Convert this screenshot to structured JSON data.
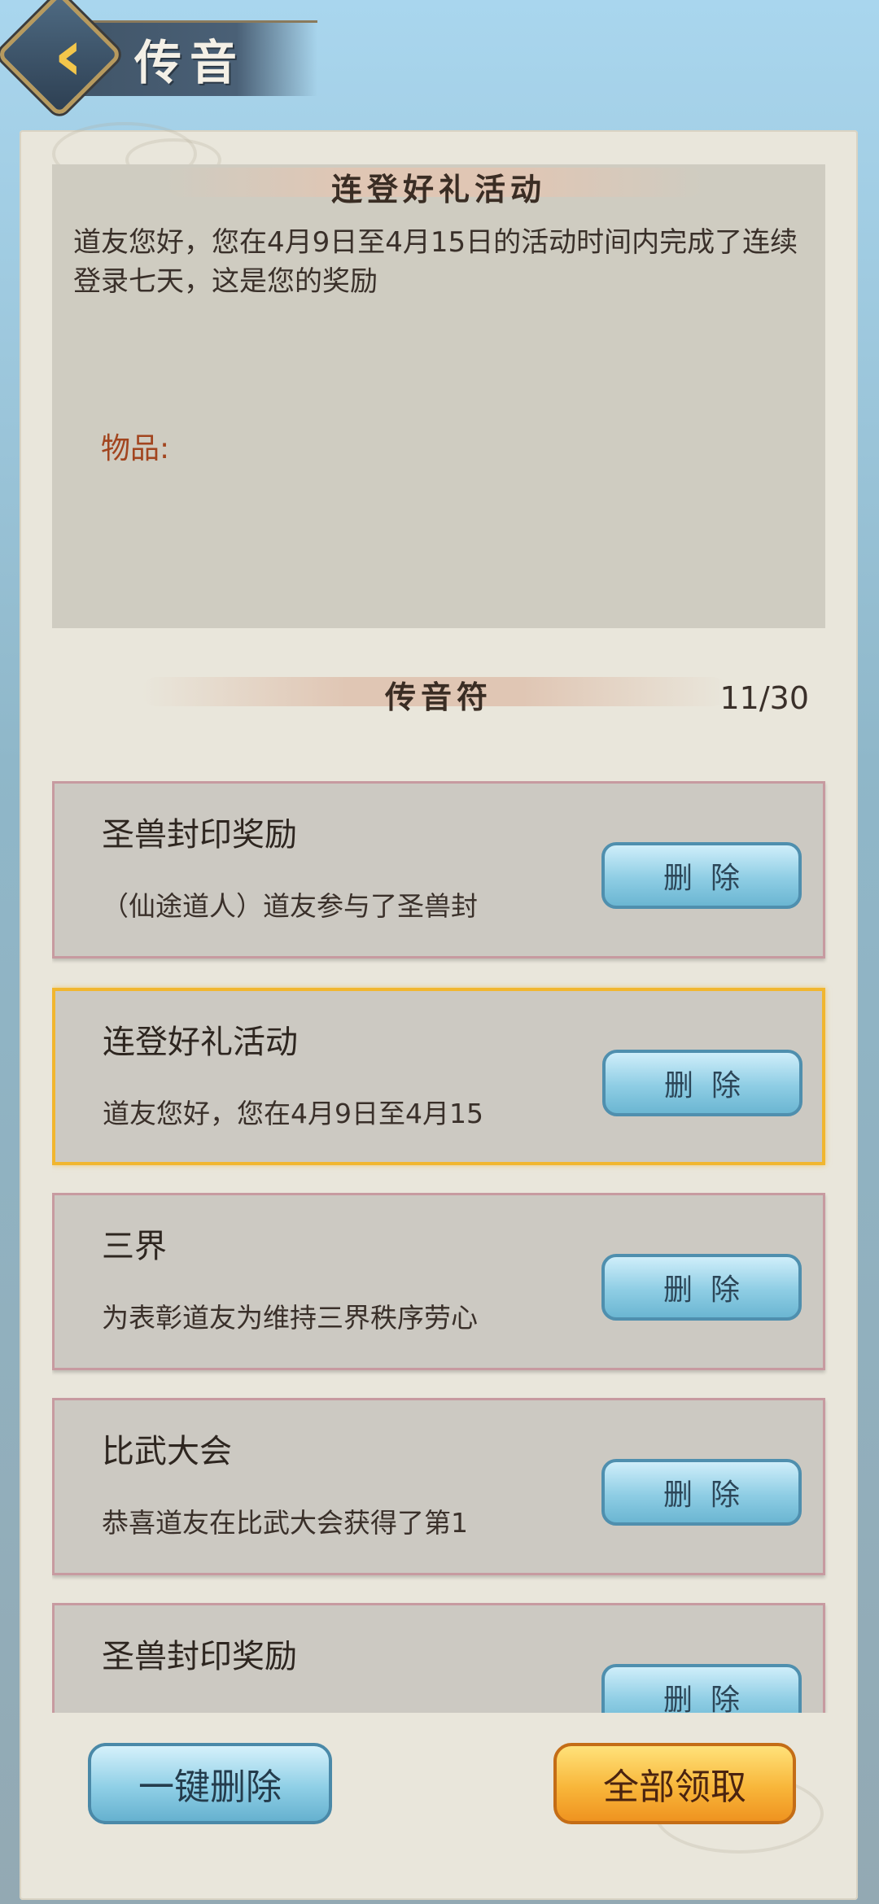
{
  "header": {
    "title": "传音",
    "back_icon": "chevron-left-icon"
  },
  "message": {
    "title": "连登好礼活动",
    "body": "道友您好，您在4月9日至4月15日的活动时间内完成了连续登录七天，这是您的奖励",
    "items_label": "物品:"
  },
  "list": {
    "section_title": "传音符",
    "count": "11/30",
    "items": [
      {
        "title": "圣兽封印奖励",
        "preview": "（仙途道人）道友参与了圣兽封",
        "delete_label": "删除",
        "selected": false
      },
      {
        "title": "连登好礼活动",
        "preview": "道友您好，您在4月9日至4月15",
        "delete_label": "删除",
        "selected": true
      },
      {
        "title": "三界",
        "preview": "为表彰道友为维持三界秩序劳心",
        "delete_label": "删除",
        "selected": false
      },
      {
        "title": "比武大会",
        "preview": "恭喜道友在比武大会获得了第1",
        "delete_label": "删除",
        "selected": false
      },
      {
        "title": "圣兽封印奖励",
        "preview": "",
        "delete_label": "删除",
        "selected": false
      }
    ]
  },
  "footer": {
    "delete_all_label": "一键删除",
    "claim_all_label": "全部领取"
  },
  "colors": {
    "accent_gold": "#f1b62f",
    "item_label_red": "#a2451f",
    "delete_blue": "#8ecde4",
    "claim_orange": "#f8b63a"
  }
}
